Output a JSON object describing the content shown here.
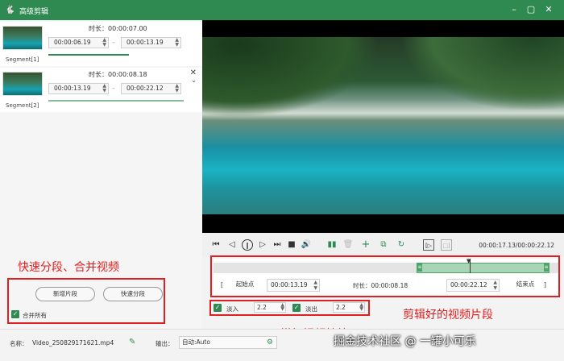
{
  "window": {
    "title": "高级剪辑",
    "logo_icon": "rabbit-logo",
    "controls": [
      "minimize",
      "maximize",
      "close"
    ]
  },
  "segments": [
    {
      "label": "Segment[1]",
      "duration": "时长：00:00:07.00",
      "start": "00:00:06.19",
      "end": "00:00:13.19"
    },
    {
      "label": "Segment[2]",
      "duration": "时长：00:00:08.18",
      "start": "00:00:13.19",
      "end": "00:00:22.12"
    }
  ],
  "segment_separator": "–",
  "player": {
    "time_display": "00:00:17.13/00:00:22.12"
  },
  "range": {
    "start_btn": "起始点",
    "start": "00:00:13.19",
    "duration": "时长：00:00:08.18",
    "end": "00:00:22.12",
    "end_btn": "结束点",
    "bracket_open": "[",
    "bracket_close": "]"
  },
  "effects": {
    "fade_in_label": "淡入",
    "fade_in_value": "2.2",
    "fade_out_label": "淡出",
    "fade_out_value": "2.2"
  },
  "left_actions": {
    "add_segment": "新增片段",
    "quick_split": "快速分段",
    "merge_all": "合并所有"
  },
  "annotations": {
    "split_merge": "快速分段、合并视频",
    "effects": "增加视频特效",
    "clips": "剪辑好的视频片段"
  },
  "bottom": {
    "name_label": "名称：",
    "name_value": "Video_250829171621.mp4",
    "output_label": "输出：",
    "output_value": "自动:Auto"
  },
  "watermark": "掘金技术社区 @ 一罐小可乐",
  "colors": {
    "accent": "#2f8a52",
    "annotation": "#e02020"
  }
}
